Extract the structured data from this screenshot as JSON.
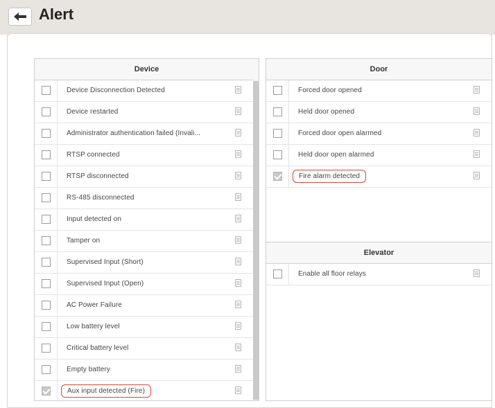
{
  "header": {
    "title": "Alert"
  },
  "device": {
    "title": "Device",
    "items": [
      {
        "label": "Device Disconnection Detected",
        "checked": false
      },
      {
        "label": "Device restarted",
        "checked": false
      },
      {
        "label": "Administrator authentication failed (Invali...",
        "checked": false
      },
      {
        "label": "RTSP connected",
        "checked": false
      },
      {
        "label": "RTSP disconnected",
        "checked": false
      },
      {
        "label": "RS-485 disconnected",
        "checked": false
      },
      {
        "label": "Input detected on",
        "checked": false
      },
      {
        "label": "Tamper on",
        "checked": false
      },
      {
        "label": "Supervised Input (Short)",
        "checked": false
      },
      {
        "label": "Supervised Input (Open)",
        "checked": false
      },
      {
        "label": "AC Power Failure",
        "checked": false
      },
      {
        "label": "Low battery level",
        "checked": false
      },
      {
        "label": "Critical battery level",
        "checked": false
      },
      {
        "label": "Empty battery",
        "checked": false
      },
      {
        "label": "Aux input detected (Fire)",
        "checked": true,
        "highlighted": true
      }
    ]
  },
  "door": {
    "title": "Door",
    "items": [
      {
        "label": "Forced door opened",
        "checked": false
      },
      {
        "label": "Held door opened",
        "checked": false
      },
      {
        "label": "Forced door open alarmed",
        "checked": false
      },
      {
        "label": "Held door open alarmed",
        "checked": false
      },
      {
        "label": "Fire alarm detected",
        "checked": true,
        "highlighted": true
      }
    ]
  },
  "elevator": {
    "title": "Elevator",
    "items": [
      {
        "label": "Enable all floor relays",
        "checked": false
      }
    ]
  },
  "colors": {
    "highlight": "#d9463b",
    "header_bg": "#e8e4df"
  },
  "icons": {
    "back": "arrow-left-icon",
    "item": "document-icon"
  }
}
